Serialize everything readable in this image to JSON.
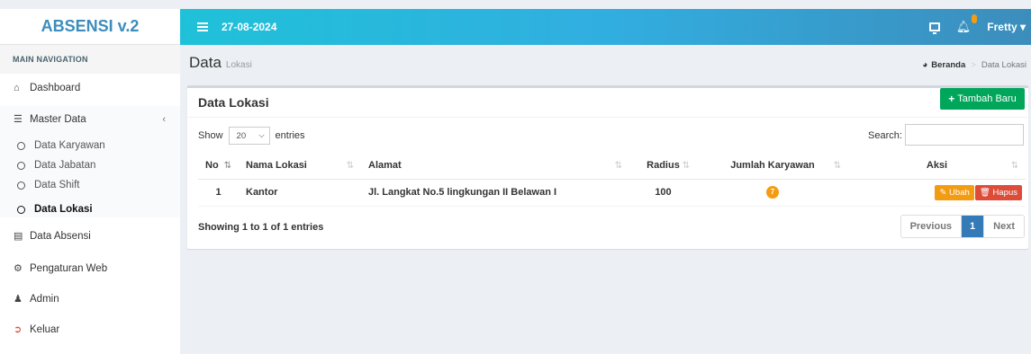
{
  "app": {
    "logo": "ABSENSI v.2"
  },
  "navbar": {
    "date": "27-08-2024",
    "notification_count": "",
    "user": "Fretty"
  },
  "sidebar": {
    "header": "MAIN NAVIGATION",
    "items": [
      {
        "label": "Dashboard",
        "icon": "home-icon"
      },
      {
        "label": "Master Data",
        "icon": "database-icon"
      },
      {
        "label": "Data Absensi",
        "icon": "table-icon"
      },
      {
        "label": "Pengaturan Web",
        "icon": "cogs-icon"
      },
      {
        "label": "Admin",
        "icon": "user-icon"
      },
      {
        "label": "Keluar",
        "icon": "sign-out-icon"
      }
    ],
    "sub_items": [
      {
        "label": "Data Karyawan"
      },
      {
        "label": "Data Jabatan"
      },
      {
        "label": "Data Shift"
      },
      {
        "label": "Data Lokasi",
        "active": true
      }
    ]
  },
  "content": {
    "title": "Data",
    "subtitle": "Lokasi",
    "breadcrumb": {
      "home": "Beranda",
      "current": "Data Lokasi"
    }
  },
  "box": {
    "title": "Data Lokasi",
    "add_button": "Tambah Baru",
    "show_label": "Show",
    "entries_value": "20",
    "entries_label": "entries",
    "search_label": "Search:",
    "search_value": ""
  },
  "table": {
    "headers": [
      "No",
      "Nama Lokasi",
      "Alamat",
      "Radius",
      "Jumlah Karyawan",
      "Aksi"
    ],
    "rows": [
      {
        "no": "1",
        "nama": "Kantor",
        "alamat": "Jl. Langkat No.5 lingkungan II Belawan I",
        "radius": "100",
        "jumlah": "7"
      }
    ],
    "edit_label": "Ubah",
    "delete_label": "Hapus"
  },
  "footer": {
    "info": "Showing 1 to 1 of 1 entries",
    "previous": "Previous",
    "page": "1",
    "next": "Next"
  },
  "colors": {
    "brand": "#3c8dbc",
    "success": "#00a65a",
    "warning": "#f39c12",
    "danger": "#dd4b39",
    "pager_active": "#337ab7"
  }
}
